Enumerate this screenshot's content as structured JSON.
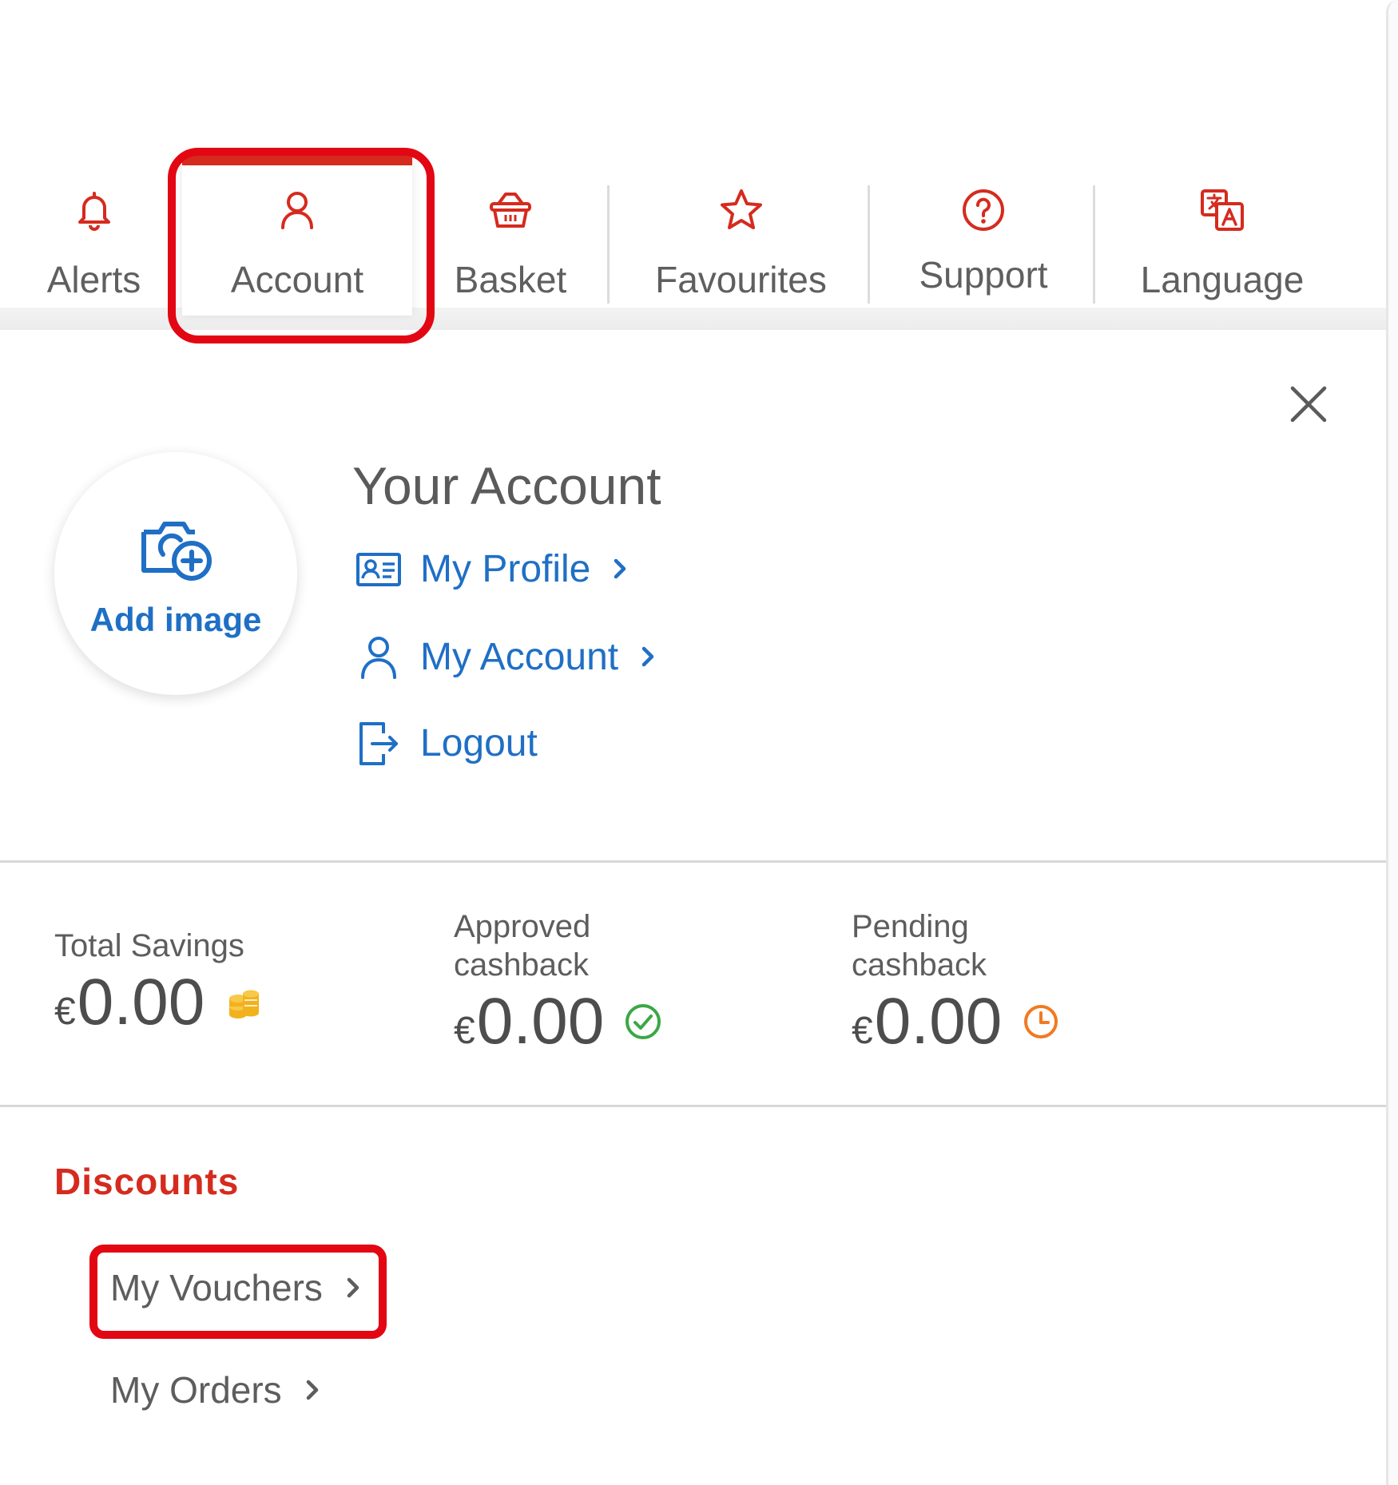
{
  "nav": {
    "items": [
      {
        "label": "Alerts",
        "icon": "bell-icon"
      },
      {
        "label": "Account",
        "icon": "user-icon"
      },
      {
        "label": "Basket",
        "icon": "basket-icon"
      },
      {
        "label": "Favourites",
        "icon": "star-icon"
      },
      {
        "label": "Support",
        "icon": "help-circle-icon"
      },
      {
        "label": "Language",
        "icon": "translate-icon"
      }
    ],
    "active_item": "Account"
  },
  "colors": {
    "brand_red": "#d52b1e",
    "highlight_red": "#e30613",
    "link_blue": "#1f6fc5",
    "approved_green": "#3aa845",
    "pending_orange": "#f07a22",
    "coins_gold": "#f2b21e"
  },
  "close_icon": "close-icon",
  "avatar": {
    "add_label": "Add image",
    "icon": "camera-add-icon"
  },
  "account": {
    "title": "Your Account",
    "links": [
      {
        "label": "My Profile",
        "icon": "id-card-icon"
      },
      {
        "label": "My Account",
        "icon": "user-icon"
      },
      {
        "label": "Logout",
        "icon": "logout-icon"
      }
    ]
  },
  "stats": [
    {
      "label_line1": "Total Savings",
      "label_line2": "",
      "currency": "€",
      "amount": "0.00",
      "icon": "coins-icon"
    },
    {
      "label_line1": "Approved",
      "label_line2": "cashback",
      "currency": "€",
      "amount": "0.00",
      "icon": "check-circle-icon"
    },
    {
      "label_line1": "Pending",
      "label_line2": "cashback",
      "currency": "€",
      "amount": "0.00",
      "icon": "clock-icon"
    }
  ],
  "discounts": {
    "title": "Discounts",
    "links": [
      {
        "label": "My Vouchers"
      },
      {
        "label": "My Orders"
      }
    ],
    "highlighted": "My Vouchers"
  }
}
